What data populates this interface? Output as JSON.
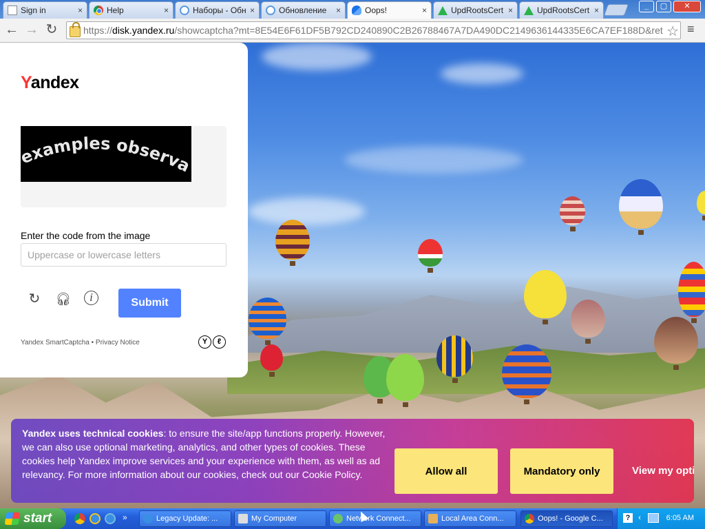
{
  "browser": {
    "tabs": [
      {
        "label": "Sign in",
        "icon": "page-icon",
        "active": false
      },
      {
        "label": "Help",
        "icon": "chrome-icon",
        "active": false
      },
      {
        "label": "Наборы - Обн",
        "icon": "yandex-icon",
        "active": false
      },
      {
        "label": "Обновление",
        "icon": "yandex-icon",
        "active": false
      },
      {
        "label": "Oops!",
        "icon": "disk-icon",
        "active": true
      },
      {
        "label": "UpdRootsCert",
        "icon": "drive-icon",
        "active": false
      },
      {
        "label": "UpdRootsCert",
        "icon": "drive-icon",
        "active": false
      }
    ],
    "close_glyph": "×",
    "window_controls": {
      "minimize": "_",
      "maximize": "▢",
      "close": "✕"
    },
    "address": {
      "scheme": "https://",
      "host": "disk.yandex.ru",
      "path": "/showcaptcha?mt=8E54E6F61DF5B792CD240890C2B26788467A7DA490DC2149636144335E6CA7EF188D&ret"
    }
  },
  "captcha": {
    "logo_first": "Y",
    "logo_rest": "andex",
    "image_text": "examples observation",
    "prompt": "Enter the code from the image",
    "input_value": "",
    "input_placeholder": "Uppercase or lowercase letters",
    "submit_label": "Submit",
    "footer": "Yandex SmartCaptcha • Privacy Notice",
    "badge_left": "Y",
    "badge_right": "ℓ"
  },
  "cookie": {
    "lead": "Yandex uses technical cookies",
    "body": ": to ensure the site/app functions properly. However, we can also use optional marketing, analytics, and other types of cookies. These cookies help Yandex improve services and your experience with them, as well as ad relevancy. For more information about our cookies, check out our ",
    "link": "Cookie Policy",
    "tail": ".",
    "allow_all": "Allow all",
    "mandatory_only": "Mandatory only",
    "view_options": "View my opti"
  },
  "taskbar": {
    "start": "start",
    "tasks": [
      {
        "label": "Legacy Update: ...",
        "icon": "ie-icon"
      },
      {
        "label": "My Computer",
        "icon": "computer-icon"
      },
      {
        "label": "Network Connect...",
        "icon": "network-icon"
      },
      {
        "label": "Local Area Conn...",
        "icon": "network-icon"
      },
      {
        "label": "Oops! - Google C...",
        "icon": "chrome-icon"
      }
    ],
    "clock": "6:05 AM",
    "expand_arrows": "»"
  },
  "colors": {
    "submit_blue": "#5282ff",
    "cookie_button": "#fce57a",
    "yandex_red": "#ff3333"
  }
}
